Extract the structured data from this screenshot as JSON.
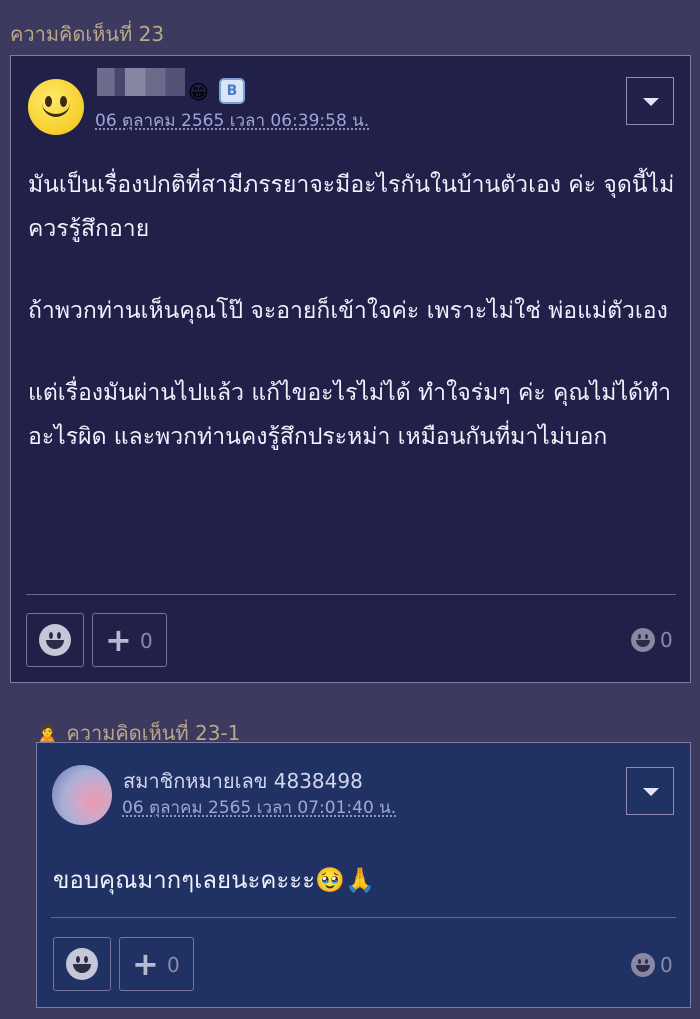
{
  "comment": {
    "header": "ความคิดเห็นที่ 23",
    "timestamp": "06 ตุลาคม 2565 เวลา 06:39:58 น.",
    "emoji_badge": "😁",
    "badge": "B",
    "paragraphs": [
      "มันเป็นเรื่องปกติที่สามีภรรยาจะมีอะไรกันในบ้านตัวเอง ค่ะ จุดนี้ไม่ควรรู้สึกอาย",
      "ถ้าพวกท่านเห็นคุณโป๊ จะอายก็เข้าใจค่ะ เพราะไม่ใช่ พ่อแม่ตัวเอง",
      "แต่เรื่องมันผ่านไปแล้ว แก้ไขอะไรไม่ได้ ทำใจร่มๆ ค่ะ คุณไม่ได้ทำอะไรผิด และพวกท่านคงรู้สึกประหม่า เหมือนกันที่มาไม่บอก"
    ],
    "plus_count": "0",
    "reaction_count": "0"
  },
  "reply": {
    "header": "ความคิดเห็นที่ 23-1",
    "person_icon": "🙎",
    "member": "สมาชิกหมายเลข 4838498",
    "timestamp": "06 ตุลาคม 2565 เวลา 07:01:40 น.",
    "text": "ขอบคุณมากๆเลยนะคะะะ",
    "emojis": "🥹🙏",
    "plus_count": "0",
    "reaction_count": "0"
  },
  "colors": {
    "page_bg": "#3c3a5f",
    "comment_bg": "#202049",
    "reply_bg": "#203263",
    "header_text": "#b9a88a",
    "timestamp": "#9fa6d7"
  }
}
